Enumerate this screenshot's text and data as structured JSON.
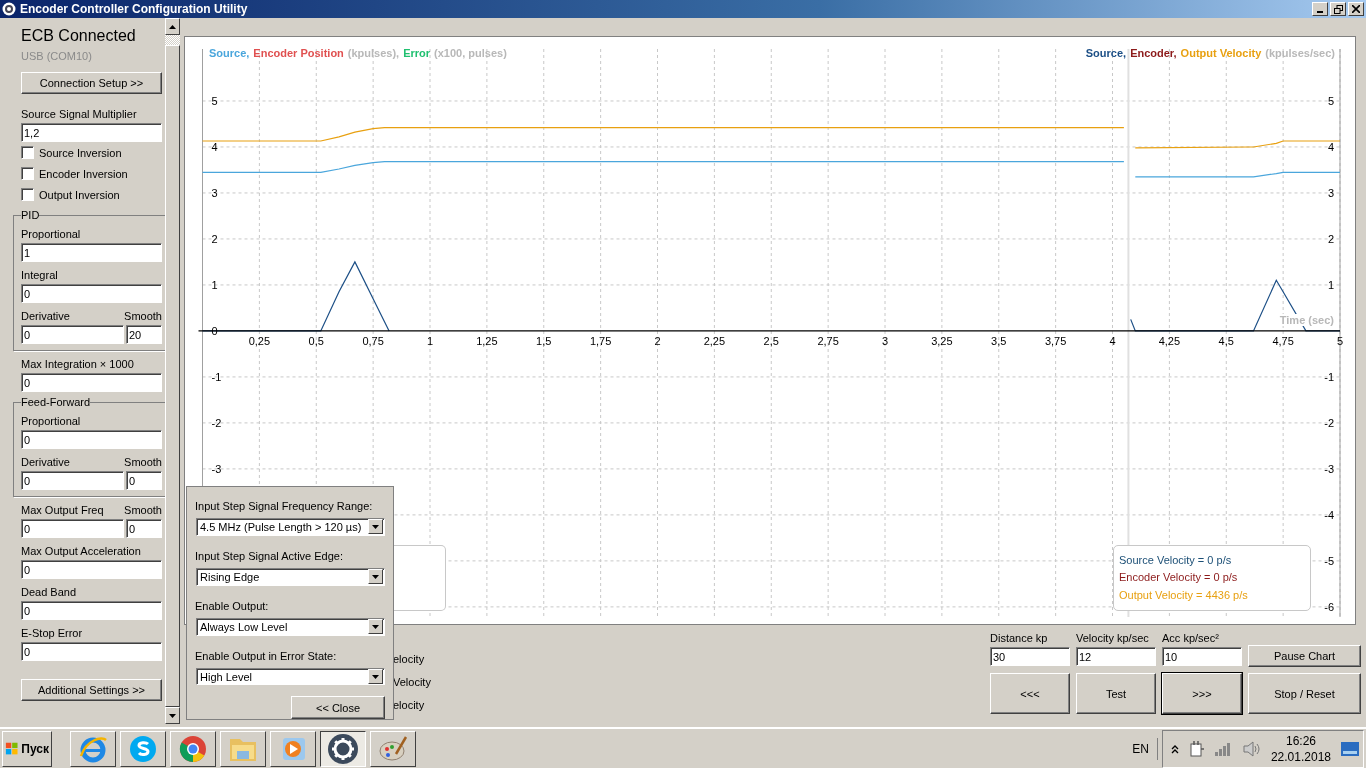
{
  "window": {
    "title": "Encoder Controller Configuration Utility"
  },
  "settings": {
    "status": "ECB Connected",
    "port": "USB (COM10)",
    "connection_button": "Connection Setup >>",
    "items": [
      {
        "kind": "field",
        "label": "Source Signal Multiplier",
        "value": "1,2"
      },
      {
        "kind": "checkbox",
        "label": "Source Inversion",
        "checked": false
      },
      {
        "kind": "checkbox",
        "label": "Encoder Inversion",
        "checked": false
      },
      {
        "kind": "checkbox",
        "label": "Output Inversion",
        "checked": false
      },
      {
        "kind": "group",
        "title": "PID",
        "items": [
          {
            "kind": "field",
            "label": "Proportional",
            "value": "1"
          },
          {
            "kind": "field",
            "label": "Integral",
            "value": "0"
          },
          {
            "kind": "pair",
            "label": "Derivative",
            "smooth_label": "Smooth",
            "value": "0",
            "smooth_value": "20"
          }
        ]
      },
      {
        "kind": "field",
        "label": "Max Integration × 1000",
        "value": "0"
      },
      {
        "kind": "group",
        "title": "Feed-Forward",
        "items": [
          {
            "kind": "field",
            "label": "Proportional",
            "value": "0"
          },
          {
            "kind": "pair",
            "label": "Derivative",
            "smooth_label": "Smooth",
            "value": "0",
            "smooth_value": "0"
          }
        ]
      },
      {
        "kind": "pair",
        "label": "Max Output Freq",
        "smooth_label": "Smooth",
        "value": "0",
        "smooth_value": "0"
      },
      {
        "kind": "field",
        "label": "Max Output Acceleration",
        "value": "0"
      },
      {
        "kind": "field",
        "label": "Dead Band",
        "value": "0"
      },
      {
        "kind": "field",
        "label": "E-Stop Error",
        "value": "0"
      }
    ],
    "additional_button": "Additional Settings >>"
  },
  "chart": {
    "left_title": [
      {
        "text": "Source,",
        "color": "#4aa6dc"
      },
      {
        "text": "Encoder Position",
        "color": "#e05050"
      },
      {
        "text": "(kpulses),",
        "color": "#b8b8b8"
      },
      {
        "text": "Error",
        "color": "#20c070"
      },
      {
        "text": "(x100, pulses)",
        "color": "#b8b8b8"
      }
    ],
    "right_title": [
      {
        "text": "Source,",
        "color": "#1c4f86"
      },
      {
        "text": "Encoder,",
        "color": "#8c1a1a"
      },
      {
        "text": "Output Velocity",
        "color": "#e8a010"
      },
      {
        "text": "(kpulses/sec)",
        "color": "#b8b8b8"
      }
    ],
    "readouts": [
      {
        "text": "Source Velocity = 0 p/s",
        "color": "#1c4f76"
      },
      {
        "text": "Encoder Velocity = 0 p/s",
        "color": "#8c1a1a"
      },
      {
        "text": "Output Velocity = 4436 p/s",
        "color": "#e8a010"
      }
    ],
    "chart_data": {
      "type": "line",
      "xlabel": "Time (sec)",
      "xlim": [
        0,
        5
      ],
      "ylim": [
        -6.22,
        6.13
      ],
      "y2lim": [
        -6.22,
        6.13
      ],
      "grid": true,
      "ref_lines": [
        {
          "axis": "x",
          "value": 4.07
        }
      ],
      "x": [
        0,
        0.52,
        0.6,
        0.67,
        0.75,
        0.8,
        0.82,
        4.05,
        4.08,
        4.1,
        4.6,
        4.62,
        4.72,
        4.75,
        4.85,
        5
      ],
      "series": [
        {
          "color": "#4aa6dc",
          "values": [
            3.45,
            3.45,
            3.52,
            3.6,
            3.66,
            3.68,
            3.68,
            3.68,
            null,
            3.35,
            3.35,
            3.35,
            3.42,
            3.45,
            3.45,
            3.45
          ]
        },
        {
          "color": "#e8a010",
          "values": [
            4.13,
            4.13,
            4.22,
            4.32,
            4.4,
            4.42,
            4.42,
            4.42,
            null,
            3.98,
            4.0,
            4.0,
            4.08,
            4.13,
            4.13,
            4.13
          ]
        },
        {
          "color": "#1c4f86",
          "values": [
            0,
            0,
            0.85,
            1.5,
            0.7,
            0.2,
            0,
            null,
            0.25,
            0,
            0,
            0,
            1.1,
            0.85,
            0,
            0
          ]
        }
      ],
      "xticks": [
        {
          "value": 0.25,
          "label": "0,25"
        },
        {
          "value": 0.5,
          "label": "0,5"
        },
        {
          "value": 0.75,
          "label": "0,75"
        },
        {
          "value": 1,
          "label": "1"
        },
        {
          "value": 1.25,
          "label": "1,25"
        },
        {
          "value": 1.5,
          "label": "1,5"
        },
        {
          "value": 1.75,
          "label": "1,75"
        },
        {
          "value": 2,
          "label": "2"
        },
        {
          "value": 2.25,
          "label": "2,25"
        },
        {
          "value": 2.5,
          "label": "2,5"
        },
        {
          "value": 2.75,
          "label": "2,75"
        },
        {
          "value": 3,
          "label": "3"
        },
        {
          "value": 3.25,
          "label": "3,25"
        },
        {
          "value": 3.5,
          "label": "3,5"
        },
        {
          "value": 3.75,
          "label": "3,75"
        },
        {
          "value": 4,
          "label": "4"
        },
        {
          "value": 4.25,
          "label": "4,25"
        },
        {
          "value": 4.5,
          "label": "4,5"
        },
        {
          "value": 4.75,
          "label": "4,75"
        },
        {
          "value": 5,
          "label": "5"
        }
      ],
      "yticks": [
        {
          "value": 5,
          "label": "5"
        },
        {
          "value": 4,
          "label": "4"
        },
        {
          "value": 3,
          "label": "3"
        },
        {
          "value": 2,
          "label": "2"
        },
        {
          "value": 1,
          "label": "1"
        },
        {
          "value": 0,
          "label": "0"
        },
        {
          "value": -1,
          "label": "-1"
        },
        {
          "value": -2,
          "label": "-2"
        },
        {
          "value": -3,
          "label": "-3"
        }
      ],
      "y2ticks": [
        {
          "value": 5,
          "label": "5"
        },
        {
          "value": 4,
          "label": "4"
        },
        {
          "value": 3,
          "label": "3"
        },
        {
          "value": 2,
          "label": "2"
        },
        {
          "value": 1,
          "label": "1"
        },
        {
          "value": -1,
          "label": "-1"
        },
        {
          "value": -2,
          "label": "-2"
        },
        {
          "value": -3,
          "label": "-3"
        },
        {
          "value": -4,
          "label": "-4"
        },
        {
          "value": -5,
          "label": "-5"
        },
        {
          "value": -6,
          "label": "-6"
        }
      ]
    }
  },
  "cut_labels": [
    "elocity",
    "Velocity",
    "elocity"
  ],
  "test_controls": {
    "inputs": [
      {
        "label": "Distance kp",
        "value": "30"
      },
      {
        "label": "Velocity kp/sec",
        "value": "12"
      },
      {
        "label": "Acc  kp/sec²",
        "value": "10"
      }
    ],
    "pause_button": "Pause Chart",
    "buttons": [
      {
        "label": "<<<",
        "focused": false
      },
      {
        "label": "Test",
        "focused": false
      },
      {
        "label": ">>>",
        "focused": true
      }
    ],
    "stop_button": "Stop / Reset"
  },
  "popup": {
    "fields": [
      {
        "label": "Input Step Signal Frequency Range:",
        "value": "4.5 MHz (Pulse Length > 120 µs)"
      },
      {
        "label": "Input Step Signal Active Edge:",
        "value": "Rising Edge"
      },
      {
        "label": "Enable Output:",
        "value": "Always Low Level"
      },
      {
        "label": "Enable Output in Error State:",
        "value": "High Level"
      }
    ],
    "close_button": "<< Close"
  },
  "taskbar": {
    "start": "Пуск",
    "apps": [
      {
        "kind": "browser",
        "selected": false
      },
      {
        "kind": "chat",
        "selected": false
      },
      {
        "kind": "round-browser",
        "selected": false
      },
      {
        "kind": "folder",
        "selected": false
      },
      {
        "kind": "player",
        "selected": false
      },
      {
        "kind": "gear",
        "selected": true
      },
      {
        "kind": "palette",
        "selected": false
      }
    ],
    "language": "EN",
    "time": "16:26",
    "date": "22.01.2018"
  }
}
